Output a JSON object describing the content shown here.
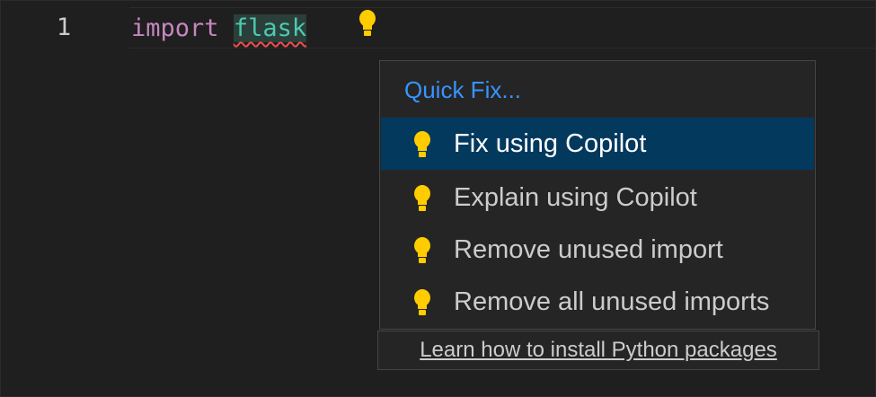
{
  "editor": {
    "line_number": "1",
    "code": {
      "keyword": "import",
      "module": "flask",
      "diagnostic": "error-squiggle"
    },
    "lightbulb_icon": "lightbulb-icon"
  },
  "quick_fix": {
    "title": "Quick Fix...",
    "actions": [
      {
        "label": "Fix using Copilot",
        "icon": "lightbulb-icon",
        "selected": true
      },
      {
        "label": "Explain using Copilot",
        "icon": "lightbulb-icon",
        "selected": false
      },
      {
        "label": "Remove unused import",
        "icon": "lightbulb-icon",
        "selected": false
      },
      {
        "label": "Remove all unused imports",
        "icon": "lightbulb-icon",
        "selected": false
      }
    ],
    "learn_link": "Learn how to install Python packages"
  },
  "colors": {
    "editor_background": "#1f1f1f",
    "keyword": "#c586c0",
    "module": "#4ec9b0",
    "error_squiggle": "#f14c4c",
    "lightbulb": "#ffcc00",
    "title_accent": "#3794ff",
    "selection": "#04395e",
    "widget_background": "#252526"
  }
}
